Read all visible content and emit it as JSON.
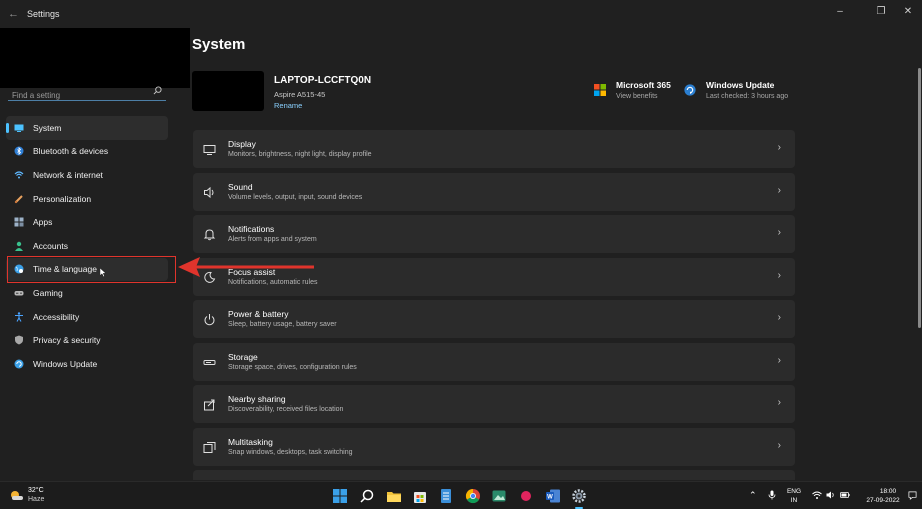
{
  "window": {
    "title": "Settings",
    "back_icon": "back-arrow-icon",
    "controls": [
      "minimize-icon",
      "maximize-icon",
      "close-icon"
    ]
  },
  "sidebar": {
    "search_placeholder": "Find a setting",
    "items": [
      {
        "label": "System",
        "icon": "system-icon",
        "color": "#4cc2ff"
      },
      {
        "label": "Bluetooth & devices",
        "icon": "bluetooth-icon",
        "color": "#4aa3ff"
      },
      {
        "label": "Network & internet",
        "icon": "wifi-icon",
        "color": "#5fb8ff"
      },
      {
        "label": "Personalization",
        "icon": "brush-icon",
        "color": "#e9a25f"
      },
      {
        "label": "Apps",
        "icon": "apps-icon",
        "color": "#9db2c8"
      },
      {
        "label": "Accounts",
        "icon": "person-icon",
        "color": "#39c08d"
      },
      {
        "label": "Time & language",
        "icon": "globe-clock-icon",
        "color": "#3aa0e8"
      },
      {
        "label": "Gaming",
        "icon": "gamepad-icon",
        "color": "#b8b8b8"
      },
      {
        "label": "Accessibility",
        "icon": "accessibility-icon",
        "color": "#4aa3ff"
      },
      {
        "label": "Privacy & security",
        "icon": "shield-icon",
        "color": "#a8a8a8"
      },
      {
        "label": "Windows Update",
        "icon": "update-icon",
        "color": "#3aa0e8"
      }
    ]
  },
  "main": {
    "title": "System",
    "device": {
      "name": "LAPTOP-LCCFTQ0N",
      "model": "Aspire A515-45",
      "rename_label": "Rename"
    },
    "tiles": [
      {
        "name": "Microsoft 365",
        "sub": "View benefits",
        "icon": "microsoft-logo-icon"
      },
      {
        "name": "Windows Update",
        "sub": "Last checked: 3 hours ago",
        "icon": "windows-update-icon"
      }
    ],
    "cards": [
      {
        "title": "Display",
        "sub": "Monitors, brightness, night light, display profile",
        "icon": "display-icon"
      },
      {
        "title": "Sound",
        "sub": "Volume levels, output, input, sound devices",
        "icon": "speaker-icon"
      },
      {
        "title": "Notifications",
        "sub": "Alerts from apps and system",
        "icon": "bell-icon"
      },
      {
        "title": "Focus assist",
        "sub": "Notifications, automatic rules",
        "icon": "moon-icon"
      },
      {
        "title": "Power & battery",
        "sub": "Sleep, battery usage, battery saver",
        "icon": "power-icon"
      },
      {
        "title": "Storage",
        "sub": "Storage space, drives, configuration rules",
        "icon": "storage-icon"
      },
      {
        "title": "Nearby sharing",
        "sub": "Discoverability, received files location",
        "icon": "share-icon"
      },
      {
        "title": "Multitasking",
        "sub": "Snap windows, desktops, task switching",
        "icon": "multitask-icon"
      }
    ]
  },
  "taskbar": {
    "weather": {
      "temp": "32°C",
      "desc": "Haze",
      "icon": "sun-haze-icon"
    },
    "apps": [
      "start-icon",
      "search-icon",
      "file-explorer-icon",
      "store-icon",
      "notepad-icon",
      "chrome-icon",
      "photos-icon",
      "app-red-icon",
      "word-icon",
      "settings-icon"
    ],
    "lang_top": "ENG",
    "lang_bottom": "IN",
    "time": "18:00",
    "date": "27-09-2022"
  },
  "colors": {
    "accent": "#4cc2ff",
    "highlight_box": "#e0342c",
    "arrow": "#e0342c",
    "card_bg": "#2b2b2b",
    "window_bg": "#202020"
  }
}
